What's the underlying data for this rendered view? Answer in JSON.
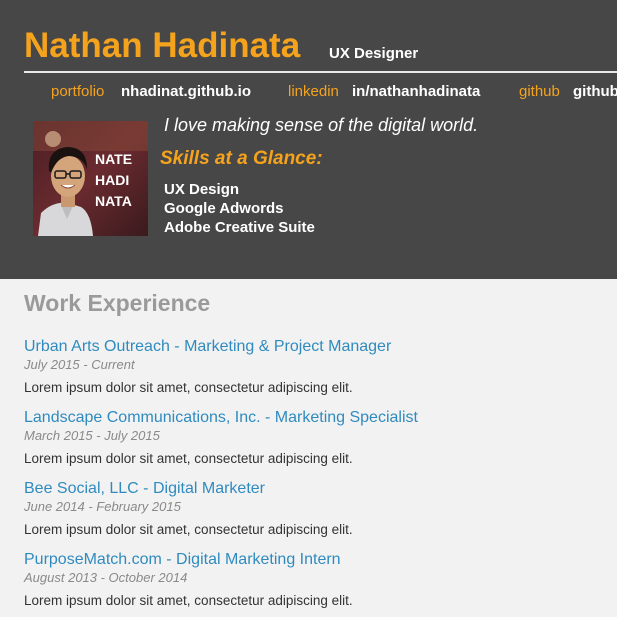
{
  "header": {
    "name": "Nathan Hadinata",
    "role": "UX Designer",
    "links": [
      {
        "label": "portfolio",
        "value": "nhadinat.github.io"
      },
      {
        "label": "linkedin",
        "value": "in/nathanhadinata"
      },
      {
        "label": "github",
        "value": "github"
      }
    ],
    "photo_text": [
      "NATE",
      "HADI",
      "NATA"
    ],
    "tagline": "I love making sense of the digital world.",
    "skills_title": "Skills at a Glance:",
    "skills": [
      "UX Design",
      "Google Adwords",
      "Adobe Creative Suite"
    ]
  },
  "work": {
    "title": "Work Experience",
    "jobs": [
      {
        "title": "Urban Arts Outreach - Marketing & Project Manager",
        "dates": "July 2015 - Current",
        "desc": "Lorem ipsum dolor sit amet, consectetur adipiscing elit."
      },
      {
        "title": "Landscape Communications, Inc. - Marketing Specialist",
        "dates": "March 2015 - July 2015",
        "desc": "Lorem ipsum dolor sit amet, consectetur adipiscing elit."
      },
      {
        "title": "Bee Social, LLC - Digital Marketer",
        "dates": "June 2014 - February 2015",
        "desc": "Lorem ipsum dolor sit amet, consectetur adipiscing elit."
      },
      {
        "title": "PurposeMatch.com - Digital Marketing Intern",
        "dates": "August 2013 - October 2014",
        "desc": "Lorem ipsum dolor sit amet, consectetur adipiscing elit."
      }
    ]
  },
  "colors": {
    "accent": "#f5a31d",
    "header_bg": "#474747",
    "link": "#2f8bbf",
    "page_bg": "#f2f2f2"
  }
}
